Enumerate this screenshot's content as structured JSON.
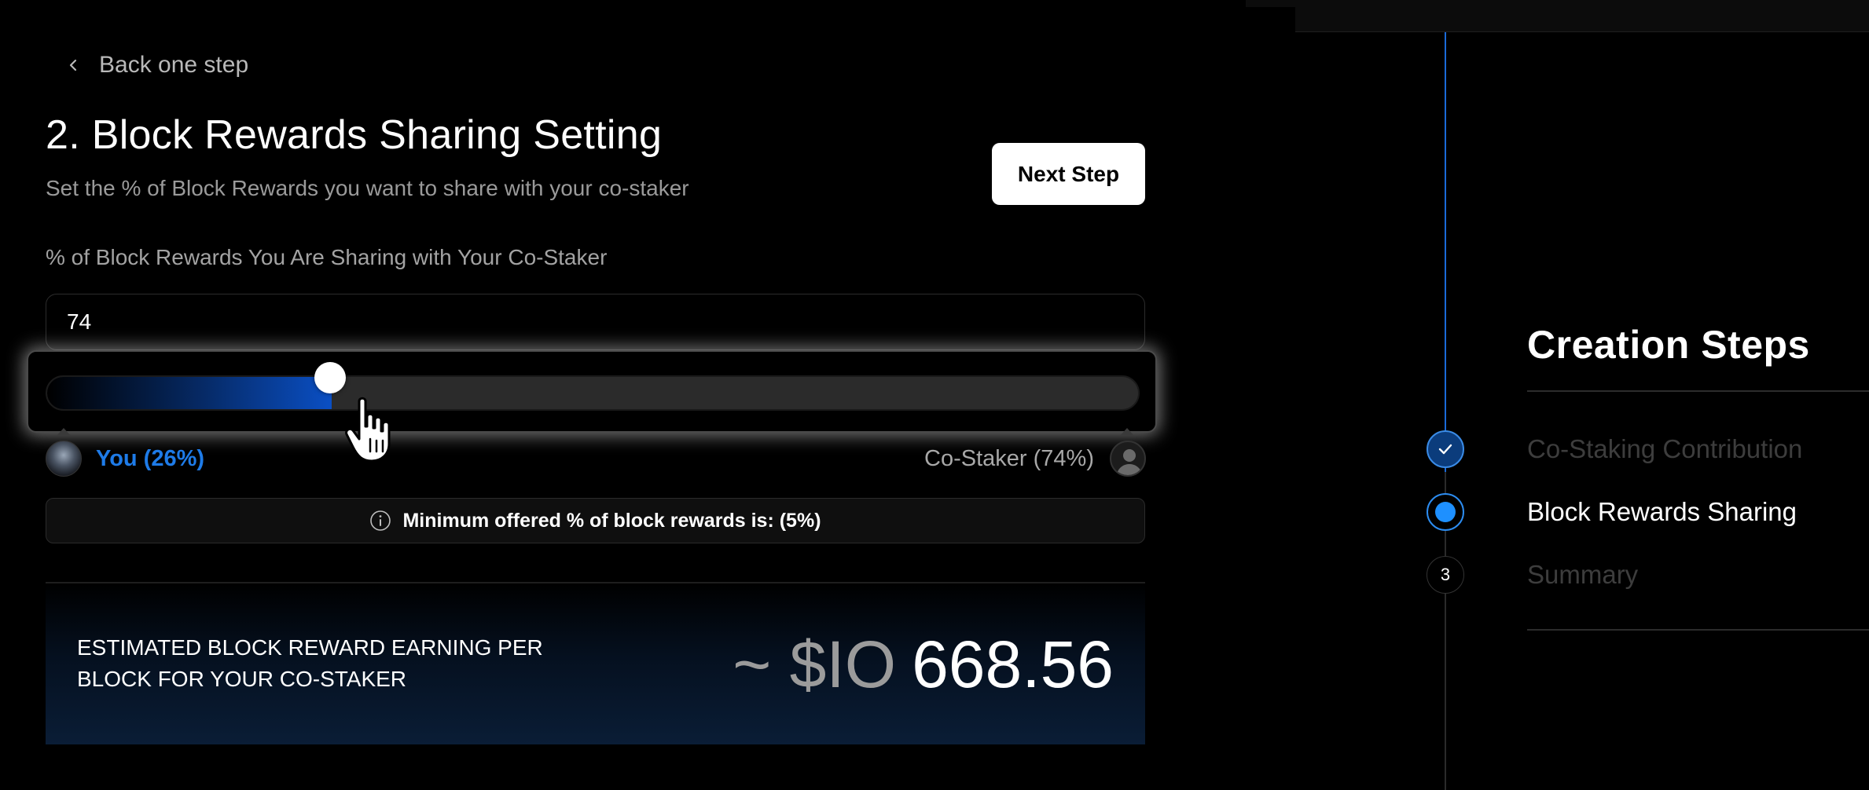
{
  "nav": {
    "back_label": "Back one step"
  },
  "header": {
    "title": "2. Block Rewards Sharing Setting",
    "subtitle": "Set the % of Block Rewards you want to share with your co-staker",
    "next_button": "Next Step"
  },
  "sharing": {
    "field_label": "% of Block Rewards You Are Sharing with Your Co-Staker",
    "input_value": "74",
    "slider_you_fraction": 0.26,
    "you_label": "You (26%)",
    "costaker_label": "Co-Staker (74%)"
  },
  "info": {
    "icon": "info-icon",
    "text": "Minimum offered % of block rewards is: (5%)"
  },
  "estimate": {
    "label_line1": "ESTIMATED BLOCK REWARD EARNING PER",
    "label_line2": "BLOCK FOR YOUR CO-STAKER",
    "prefix": "~ $IO",
    "value": "668.56"
  },
  "steps": {
    "title": "Creation Steps",
    "items": [
      {
        "label": "Co-Staking Contribution",
        "state": "done",
        "icon": "check-icon"
      },
      {
        "label": "Block Rewards Sharing",
        "state": "active"
      },
      {
        "label": "Summary",
        "state": "pending",
        "number": "3"
      }
    ]
  },
  "colors": {
    "accent_blue": "#1e7be8",
    "background": "#000000",
    "muted_text": "#9a9a9a"
  }
}
